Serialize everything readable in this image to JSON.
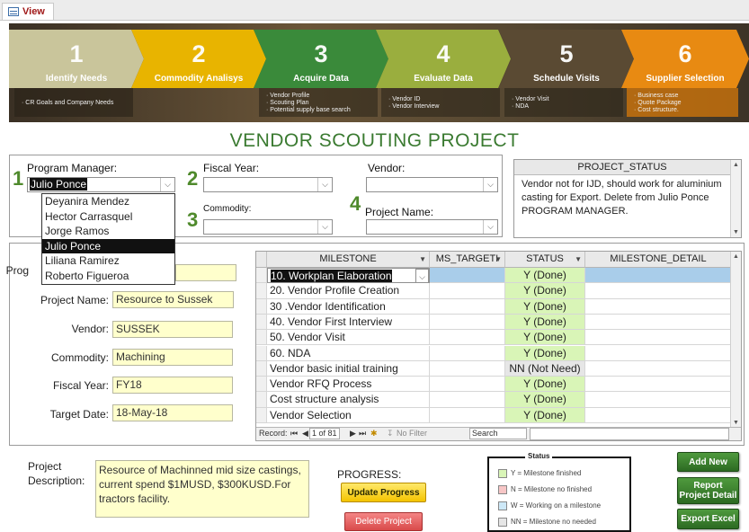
{
  "tab": {
    "label": "View"
  },
  "banner": {
    "steps": [
      {
        "num": "1",
        "label": "Identify Needs",
        "color": "#c9c59b",
        "sub": [
          "CR Goals and Company Needs"
        ]
      },
      {
        "num": "2",
        "label": "Commodity Analisys",
        "color": "#e8b400",
        "sub": []
      },
      {
        "num": "3",
        "label": "Acquire Data",
        "color": "#3a8a3a",
        "sub": [
          "Vendor Profile",
          "Scouting Plan",
          "Potential supply base search"
        ]
      },
      {
        "num": "4",
        "label": "Evaluate Data",
        "color": "#9aae3e",
        "sub": [
          "Vendor ID",
          "Vendor Interview"
        ]
      },
      {
        "num": "5",
        "label": "Schedule Visits",
        "color": "#5a4a33",
        "sub": [
          "Vendor Visit",
          "NDA"
        ]
      },
      {
        "num": "6",
        "label": "Supplier Selection",
        "color": "#e88a12",
        "sub": [
          "Business case",
          "Quote Package",
          "Cost structure."
        ]
      }
    ]
  },
  "page_title": "VENDOR SCOUTING PROJECT",
  "filters": {
    "n1": "1",
    "n2": "2",
    "n3": "3",
    "n4": "4",
    "pm_label": "Program Manager:",
    "pm_value": "Julio Ponce",
    "fy_label": "Fiscal Year:",
    "fy_value": "",
    "commodity_label": "Commodity:",
    "commodity_value": "",
    "vendor_label": "Vendor:",
    "vendor_value": "",
    "project_label": "Project Name:",
    "project_value": "",
    "pm_options": [
      "Deyanira Mendez",
      "Hector Carrasquel",
      "Jorge Ramos",
      "Julio Ponce",
      "Liliana Ramirez",
      "Roberto Figueroa"
    ],
    "pm_selected_index": 3
  },
  "project_status": {
    "header": "PROJECT_STATUS",
    "text": "Vendor not for IJD, should work for aluminium casting for Export. Delete from Julio Ponce PROGRAM MANAGER."
  },
  "details": {
    "program_label": "Prog",
    "project_name_label": "Project Name:",
    "project_name": "Resource to Sussek",
    "vendor_label": "Vendor:",
    "vendor": "SUSSEK",
    "commodity_label": "Commodity:",
    "commodity": "Machining",
    "fiscal_year_label": "Fiscal Year:",
    "fiscal_year": "FY18",
    "target_date_label": "Target Date:",
    "target_date": "18-May-18"
  },
  "milestones": {
    "columns": [
      "MILESTONE",
      "MS_TARGETI",
      "STATUS",
      "MILESTONE_DETAIL"
    ],
    "rows": [
      {
        "milestone": "10. Workplan Elaboration",
        "target": "",
        "status": "Y (Done)",
        "detail": ""
      },
      {
        "milestone": "20. Vendor Profile Creation",
        "target": "",
        "status": "Y (Done)",
        "detail": ""
      },
      {
        "milestone": "30 .Vendor Identification",
        "target": "",
        "status": "Y (Done)",
        "detail": ""
      },
      {
        "milestone": "40. Vendor First Interview",
        "target": "",
        "status": "Y (Done)",
        "detail": ""
      },
      {
        "milestone": "50. Vendor Visit",
        "target": "",
        "status": "Y (Done)",
        "detail": ""
      },
      {
        "milestone": "60. NDA",
        "target": "",
        "status": "Y (Done)",
        "detail": ""
      },
      {
        "milestone": "Vendor basic initial training",
        "target": "",
        "status": "NN (Not Need)",
        "detail": ""
      },
      {
        "milestone": "Vendor RFQ Process",
        "target": "",
        "status": "Y (Done)",
        "detail": ""
      },
      {
        "milestone": "Cost structure analysis",
        "target": "",
        "status": "Y (Done)",
        "detail": ""
      },
      {
        "milestone": "Vendor Selection",
        "target": "",
        "status": "Y (Done)",
        "detail": ""
      }
    ],
    "status_colors": {
      "Y (Done)": "#d9f5b7",
      "NN (Not Need)": "#e6e6e6"
    },
    "nav": {
      "record_label": "Record:",
      "position": "1 of 81",
      "filter": "No Filter",
      "search": "Search"
    }
  },
  "bottom": {
    "description_label_1": "Project",
    "description_label_2": "Description:",
    "description": "Resource of Machinned mid size castings, current spend $1MUSD, $300KUSD.For tractors facility.",
    "progress_label": "PROGRESS:",
    "update_progress": "Update Progress",
    "delete_project": "Delete Project",
    "add_new": "Add New",
    "report_detail": "Report Project Detail",
    "export_excel": "Export Excel"
  },
  "legend": {
    "title": "Status",
    "items": [
      {
        "text": "Y = Milestone finished",
        "color": "#d9f5b7"
      },
      {
        "text": "N = Milestone no finished",
        "color": "#f7c6c6"
      },
      {
        "text": "W = Working on a milestone",
        "color": "#cde8f7"
      },
      {
        "text": "NN = Milestone no needed",
        "color": "#e6e6e6"
      }
    ]
  }
}
